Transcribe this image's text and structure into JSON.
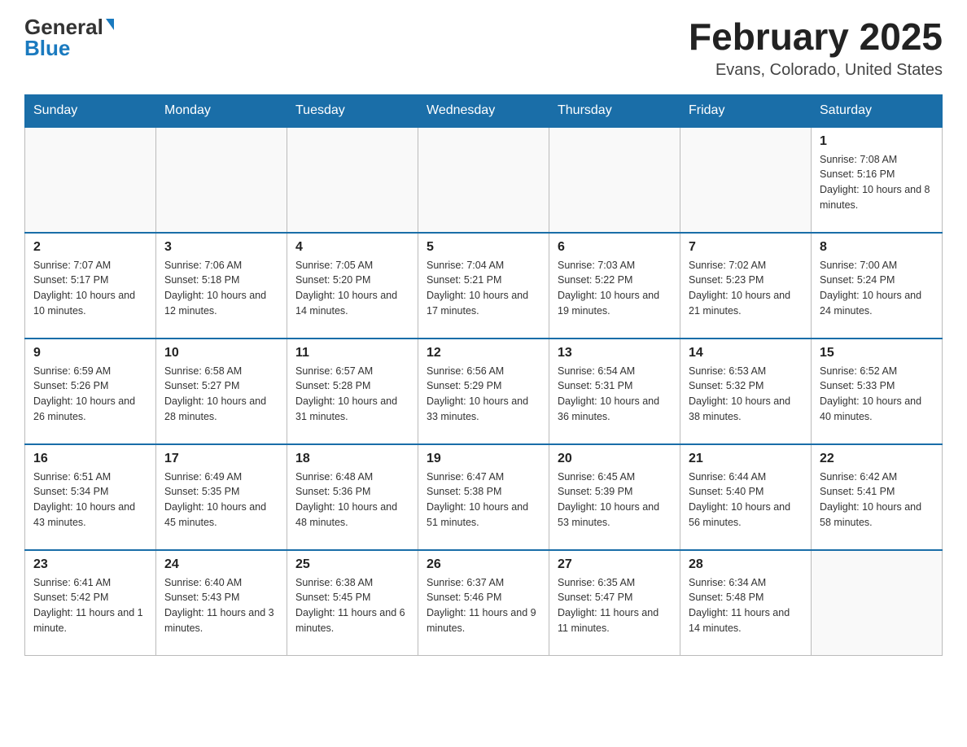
{
  "header": {
    "logo_general": "General",
    "logo_blue": "Blue",
    "month_title": "February 2025",
    "location": "Evans, Colorado, United States"
  },
  "weekdays": [
    "Sunday",
    "Monday",
    "Tuesday",
    "Wednesday",
    "Thursday",
    "Friday",
    "Saturday"
  ],
  "weeks": [
    [
      {
        "day": "",
        "sunrise": "",
        "sunset": "",
        "daylight": ""
      },
      {
        "day": "",
        "sunrise": "",
        "sunset": "",
        "daylight": ""
      },
      {
        "day": "",
        "sunrise": "",
        "sunset": "",
        "daylight": ""
      },
      {
        "day": "",
        "sunrise": "",
        "sunset": "",
        "daylight": ""
      },
      {
        "day": "",
        "sunrise": "",
        "sunset": "",
        "daylight": ""
      },
      {
        "day": "",
        "sunrise": "",
        "sunset": "",
        "daylight": ""
      },
      {
        "day": "1",
        "sunrise": "Sunrise: 7:08 AM",
        "sunset": "Sunset: 5:16 PM",
        "daylight": "Daylight: 10 hours and 8 minutes."
      }
    ],
    [
      {
        "day": "2",
        "sunrise": "Sunrise: 7:07 AM",
        "sunset": "Sunset: 5:17 PM",
        "daylight": "Daylight: 10 hours and 10 minutes."
      },
      {
        "day": "3",
        "sunrise": "Sunrise: 7:06 AM",
        "sunset": "Sunset: 5:18 PM",
        "daylight": "Daylight: 10 hours and 12 minutes."
      },
      {
        "day": "4",
        "sunrise": "Sunrise: 7:05 AM",
        "sunset": "Sunset: 5:20 PM",
        "daylight": "Daylight: 10 hours and 14 minutes."
      },
      {
        "day": "5",
        "sunrise": "Sunrise: 7:04 AM",
        "sunset": "Sunset: 5:21 PM",
        "daylight": "Daylight: 10 hours and 17 minutes."
      },
      {
        "day": "6",
        "sunrise": "Sunrise: 7:03 AM",
        "sunset": "Sunset: 5:22 PM",
        "daylight": "Daylight: 10 hours and 19 minutes."
      },
      {
        "day": "7",
        "sunrise": "Sunrise: 7:02 AM",
        "sunset": "Sunset: 5:23 PM",
        "daylight": "Daylight: 10 hours and 21 minutes."
      },
      {
        "day": "8",
        "sunrise": "Sunrise: 7:00 AM",
        "sunset": "Sunset: 5:24 PM",
        "daylight": "Daylight: 10 hours and 24 minutes."
      }
    ],
    [
      {
        "day": "9",
        "sunrise": "Sunrise: 6:59 AM",
        "sunset": "Sunset: 5:26 PM",
        "daylight": "Daylight: 10 hours and 26 minutes."
      },
      {
        "day": "10",
        "sunrise": "Sunrise: 6:58 AM",
        "sunset": "Sunset: 5:27 PM",
        "daylight": "Daylight: 10 hours and 28 minutes."
      },
      {
        "day": "11",
        "sunrise": "Sunrise: 6:57 AM",
        "sunset": "Sunset: 5:28 PM",
        "daylight": "Daylight: 10 hours and 31 minutes."
      },
      {
        "day": "12",
        "sunrise": "Sunrise: 6:56 AM",
        "sunset": "Sunset: 5:29 PM",
        "daylight": "Daylight: 10 hours and 33 minutes."
      },
      {
        "day": "13",
        "sunrise": "Sunrise: 6:54 AM",
        "sunset": "Sunset: 5:31 PM",
        "daylight": "Daylight: 10 hours and 36 minutes."
      },
      {
        "day": "14",
        "sunrise": "Sunrise: 6:53 AM",
        "sunset": "Sunset: 5:32 PM",
        "daylight": "Daylight: 10 hours and 38 minutes."
      },
      {
        "day": "15",
        "sunrise": "Sunrise: 6:52 AM",
        "sunset": "Sunset: 5:33 PM",
        "daylight": "Daylight: 10 hours and 40 minutes."
      }
    ],
    [
      {
        "day": "16",
        "sunrise": "Sunrise: 6:51 AM",
        "sunset": "Sunset: 5:34 PM",
        "daylight": "Daylight: 10 hours and 43 minutes."
      },
      {
        "day": "17",
        "sunrise": "Sunrise: 6:49 AM",
        "sunset": "Sunset: 5:35 PM",
        "daylight": "Daylight: 10 hours and 45 minutes."
      },
      {
        "day": "18",
        "sunrise": "Sunrise: 6:48 AM",
        "sunset": "Sunset: 5:36 PM",
        "daylight": "Daylight: 10 hours and 48 minutes."
      },
      {
        "day": "19",
        "sunrise": "Sunrise: 6:47 AM",
        "sunset": "Sunset: 5:38 PM",
        "daylight": "Daylight: 10 hours and 51 minutes."
      },
      {
        "day": "20",
        "sunrise": "Sunrise: 6:45 AM",
        "sunset": "Sunset: 5:39 PM",
        "daylight": "Daylight: 10 hours and 53 minutes."
      },
      {
        "day": "21",
        "sunrise": "Sunrise: 6:44 AM",
        "sunset": "Sunset: 5:40 PM",
        "daylight": "Daylight: 10 hours and 56 minutes."
      },
      {
        "day": "22",
        "sunrise": "Sunrise: 6:42 AM",
        "sunset": "Sunset: 5:41 PM",
        "daylight": "Daylight: 10 hours and 58 minutes."
      }
    ],
    [
      {
        "day": "23",
        "sunrise": "Sunrise: 6:41 AM",
        "sunset": "Sunset: 5:42 PM",
        "daylight": "Daylight: 11 hours and 1 minute."
      },
      {
        "day": "24",
        "sunrise": "Sunrise: 6:40 AM",
        "sunset": "Sunset: 5:43 PM",
        "daylight": "Daylight: 11 hours and 3 minutes."
      },
      {
        "day": "25",
        "sunrise": "Sunrise: 6:38 AM",
        "sunset": "Sunset: 5:45 PM",
        "daylight": "Daylight: 11 hours and 6 minutes."
      },
      {
        "day": "26",
        "sunrise": "Sunrise: 6:37 AM",
        "sunset": "Sunset: 5:46 PM",
        "daylight": "Daylight: 11 hours and 9 minutes."
      },
      {
        "day": "27",
        "sunrise": "Sunrise: 6:35 AM",
        "sunset": "Sunset: 5:47 PM",
        "daylight": "Daylight: 11 hours and 11 minutes."
      },
      {
        "day": "28",
        "sunrise": "Sunrise: 6:34 AM",
        "sunset": "Sunset: 5:48 PM",
        "daylight": "Daylight: 11 hours and 14 minutes."
      },
      {
        "day": "",
        "sunrise": "",
        "sunset": "",
        "daylight": ""
      }
    ]
  ]
}
